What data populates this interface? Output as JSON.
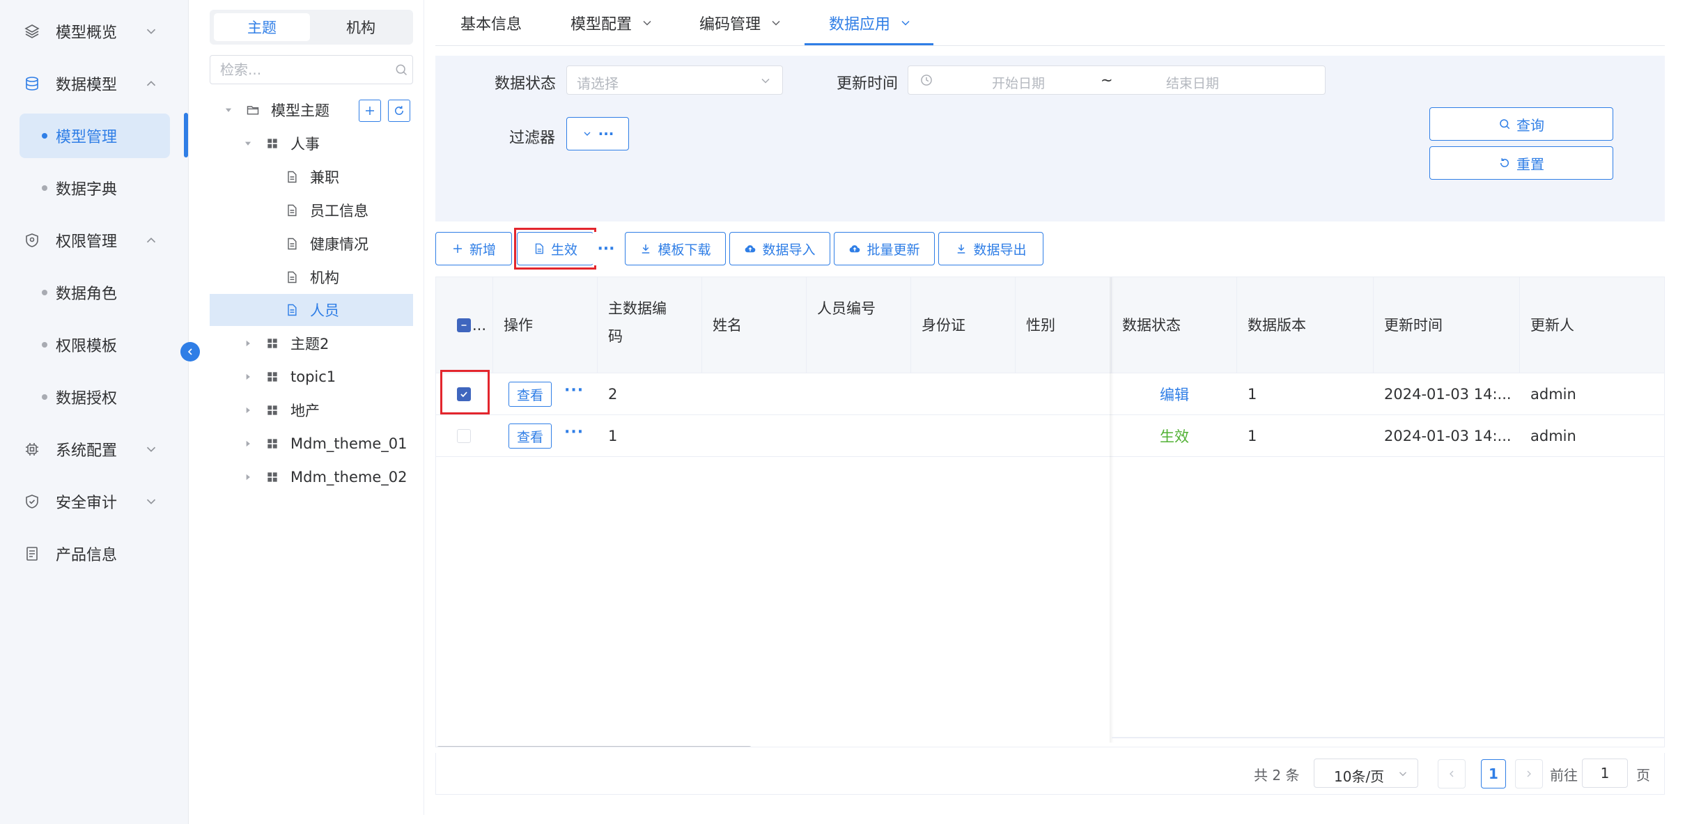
{
  "sidebar": {
    "items": [
      {
        "label": "模型概览"
      },
      {
        "label": "数据模型"
      },
      {
        "label": "权限管理"
      },
      {
        "label": "系统配置"
      },
      {
        "label": "安全审计"
      },
      {
        "label": "产品信息"
      }
    ],
    "subitems": [
      {
        "label": "模型管理"
      },
      {
        "label": "数据字典"
      },
      {
        "label": "数据角色"
      },
      {
        "label": "权限模板"
      },
      {
        "label": "数据授权"
      }
    ]
  },
  "tree_panel": {
    "segment": {
      "subject": "主题",
      "org": "机构"
    },
    "search_placeholder": "检索...",
    "nodes": [
      {
        "label": "模型主题"
      },
      {
        "label": "人事"
      },
      {
        "label": "兼职"
      },
      {
        "label": "员工信息"
      },
      {
        "label": "健康情况"
      },
      {
        "label": "机构"
      },
      {
        "label": "人员"
      },
      {
        "label": "主题2"
      },
      {
        "label": "topic1"
      },
      {
        "label": "地产"
      },
      {
        "label": "Mdm_theme_01"
      },
      {
        "label": "Mdm_theme_02"
      }
    ]
  },
  "tabs": [
    {
      "label": "基本信息"
    },
    {
      "label": "模型配置"
    },
    {
      "label": "编码管理"
    },
    {
      "label": "数据应用"
    }
  ],
  "filter": {
    "status_label": "数据状态",
    "status_placeholder": "请选择",
    "update_time_label": "更新时间",
    "start_placeholder": "开始日期",
    "range_sep": "~",
    "end_placeholder": "结束日期",
    "filter_label": "过滤器",
    "query_button": "查询",
    "reset_button": "重置"
  },
  "toolbar": {
    "add": "新增",
    "activate": "生效",
    "more": "···",
    "template_download": "模板下载",
    "data_import": "数据导入",
    "batch_update": "批量更新",
    "data_export": "数据导出"
  },
  "table": {
    "headers": {
      "select": "...",
      "op": "操作",
      "code_line1": "主数据编",
      "code_line2": "码",
      "name": "姓名",
      "emp_no": "人员编号",
      "id_card": "身份证",
      "gender": "性别",
      "status": "数据状态",
      "version": "数据版本",
      "update_time": "更新时间",
      "updater": "更新人"
    },
    "view_label": "查看",
    "more_label": "···",
    "rows": [
      {
        "code": "2",
        "status": "编辑",
        "status_color": "#2f7ee6",
        "version": "1",
        "update_time": "2024-01-03 14:...",
        "updater": "admin",
        "checked": true
      },
      {
        "code": "1",
        "status": "生效",
        "status_color": "#52b135",
        "version": "1",
        "update_time": "2024-01-03 14:...",
        "updater": "admin",
        "checked": false
      }
    ]
  },
  "pagination": {
    "total": "共 2 条",
    "page_size": "10条/页",
    "current_page": "1",
    "goto_label": "前往",
    "goto_value": "1",
    "page_suffix": "页"
  },
  "colors": {
    "primary": "#2f7ee6",
    "highlight": "#e3262d",
    "success": "#52b135",
    "sidebar_bg": "#f4f6fa",
    "filter_bg": "#f1f4fb"
  }
}
